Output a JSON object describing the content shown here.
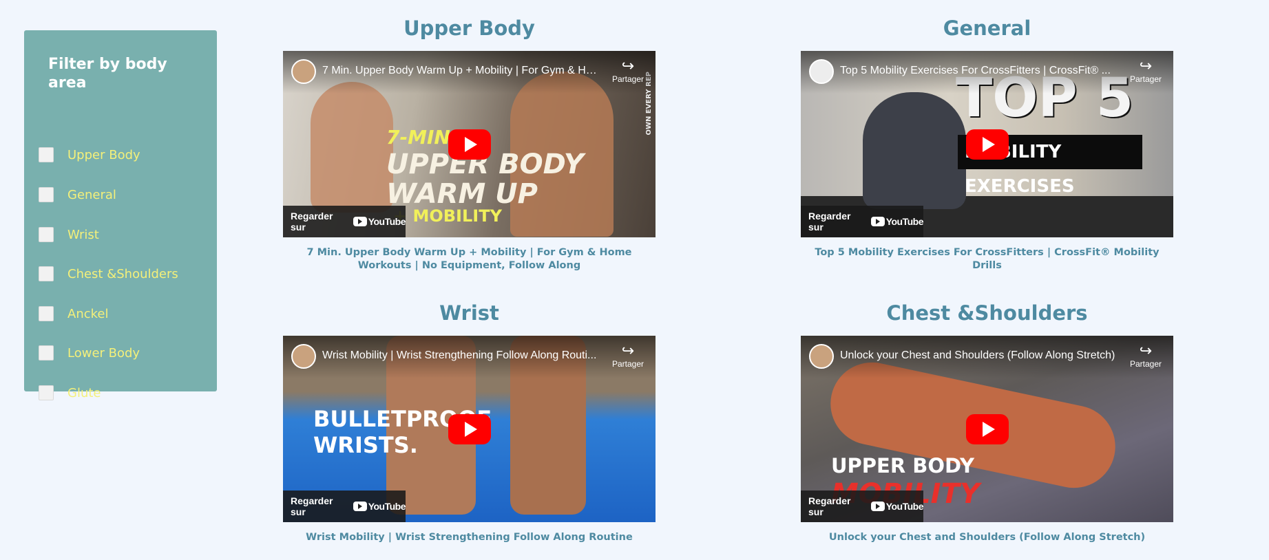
{
  "sidebar": {
    "title": "Filter by body area",
    "filters": [
      {
        "label": "Upper Body",
        "checked": false
      },
      {
        "label": "General",
        "checked": false
      },
      {
        "label": "Wrist",
        "checked": false
      },
      {
        "label": "Chest &Shoulders",
        "checked": false
      },
      {
        "label": "Anckel",
        "checked": false
      },
      {
        "label": "Lower Body",
        "checked": false
      },
      {
        "label": "Glute",
        "checked": false
      }
    ]
  },
  "embed_ui": {
    "share_label": "Partager",
    "watch_on_label": "Regarder sur",
    "youtube_label": "YouTube"
  },
  "cards": [
    {
      "heading": "Upper Body",
      "video_title": "7 Min. Upper Body Warm Up + Mobility | For Gym & Ho...",
      "caption": "7 Min. Upper Body Warm Up + Mobility | For Gym & Home Workouts | No Equipment, Follow Along",
      "overlay": {
        "small": "7-MIN",
        "line1": "UPPER BODY",
        "line2": "WARM UP",
        "line3": "+ MOBILITY",
        "side": "OWN EVERY REP"
      }
    },
    {
      "heading": "General",
      "video_title": "Top 5 Mobility Exercises For CrossFitters | CrossFit® ...",
      "caption": "Top 5 Mobility Exercises For CrossFitters | CrossFit® Mobility Drills",
      "overlay": {
        "line1": "TOP 5",
        "line2": "MOBILITY EXERCISES"
      }
    },
    {
      "heading": "Wrist",
      "video_title": "Wrist Mobility | Wrist Strengthening Follow Along Routi...",
      "caption": "Wrist Mobility | Wrist Strengthening Follow Along Routine",
      "overlay": {
        "line1": "BULLETPROOF",
        "line2": "WRISTS."
      }
    },
    {
      "heading": "Chest &Shoulders",
      "video_title": "Unlock your Chest and Shoulders (Follow Along Stretch)",
      "caption": "Unlock your Chest and Shoulders (Follow Along Stretch)",
      "overlay": {
        "line1": "UPPER BODY",
        "line2": "MOBILITY"
      }
    }
  ],
  "colors": {
    "background": "#f1f6fd",
    "sidebar": "#79b0ae",
    "filter_label": "#f4f07a",
    "heading": "#4e8aa1",
    "play_button": "#ff0000"
  }
}
